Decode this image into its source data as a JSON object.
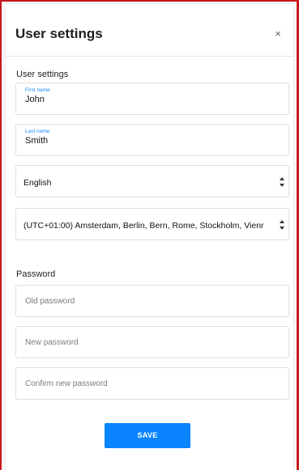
{
  "dialog": {
    "title": "User settings",
    "close_glyph": "×"
  },
  "user_settings": {
    "section_label": "User settings",
    "first_name": {
      "label": "First name",
      "value": "John"
    },
    "last_name": {
      "label": "Last name",
      "value": "Smith"
    },
    "language": {
      "selected": "English"
    },
    "timezone": {
      "selected": "(UTC+01:00) Amsterdam, Berlin, Bern, Rome, Stockholm, Vienr"
    }
  },
  "password": {
    "section_label": "Password",
    "old_placeholder": "Old password",
    "new_placeholder": "New password",
    "confirm_placeholder": "Confirm new password"
  },
  "actions": {
    "save_label": "SAVE"
  },
  "colors": {
    "accent": "#0a84ff",
    "frame_edge": "#c9151b",
    "floating_label": "#1a8cff"
  },
  "icons": {
    "close": "close-icon",
    "select_arrow": "updown-chevron-icon"
  }
}
